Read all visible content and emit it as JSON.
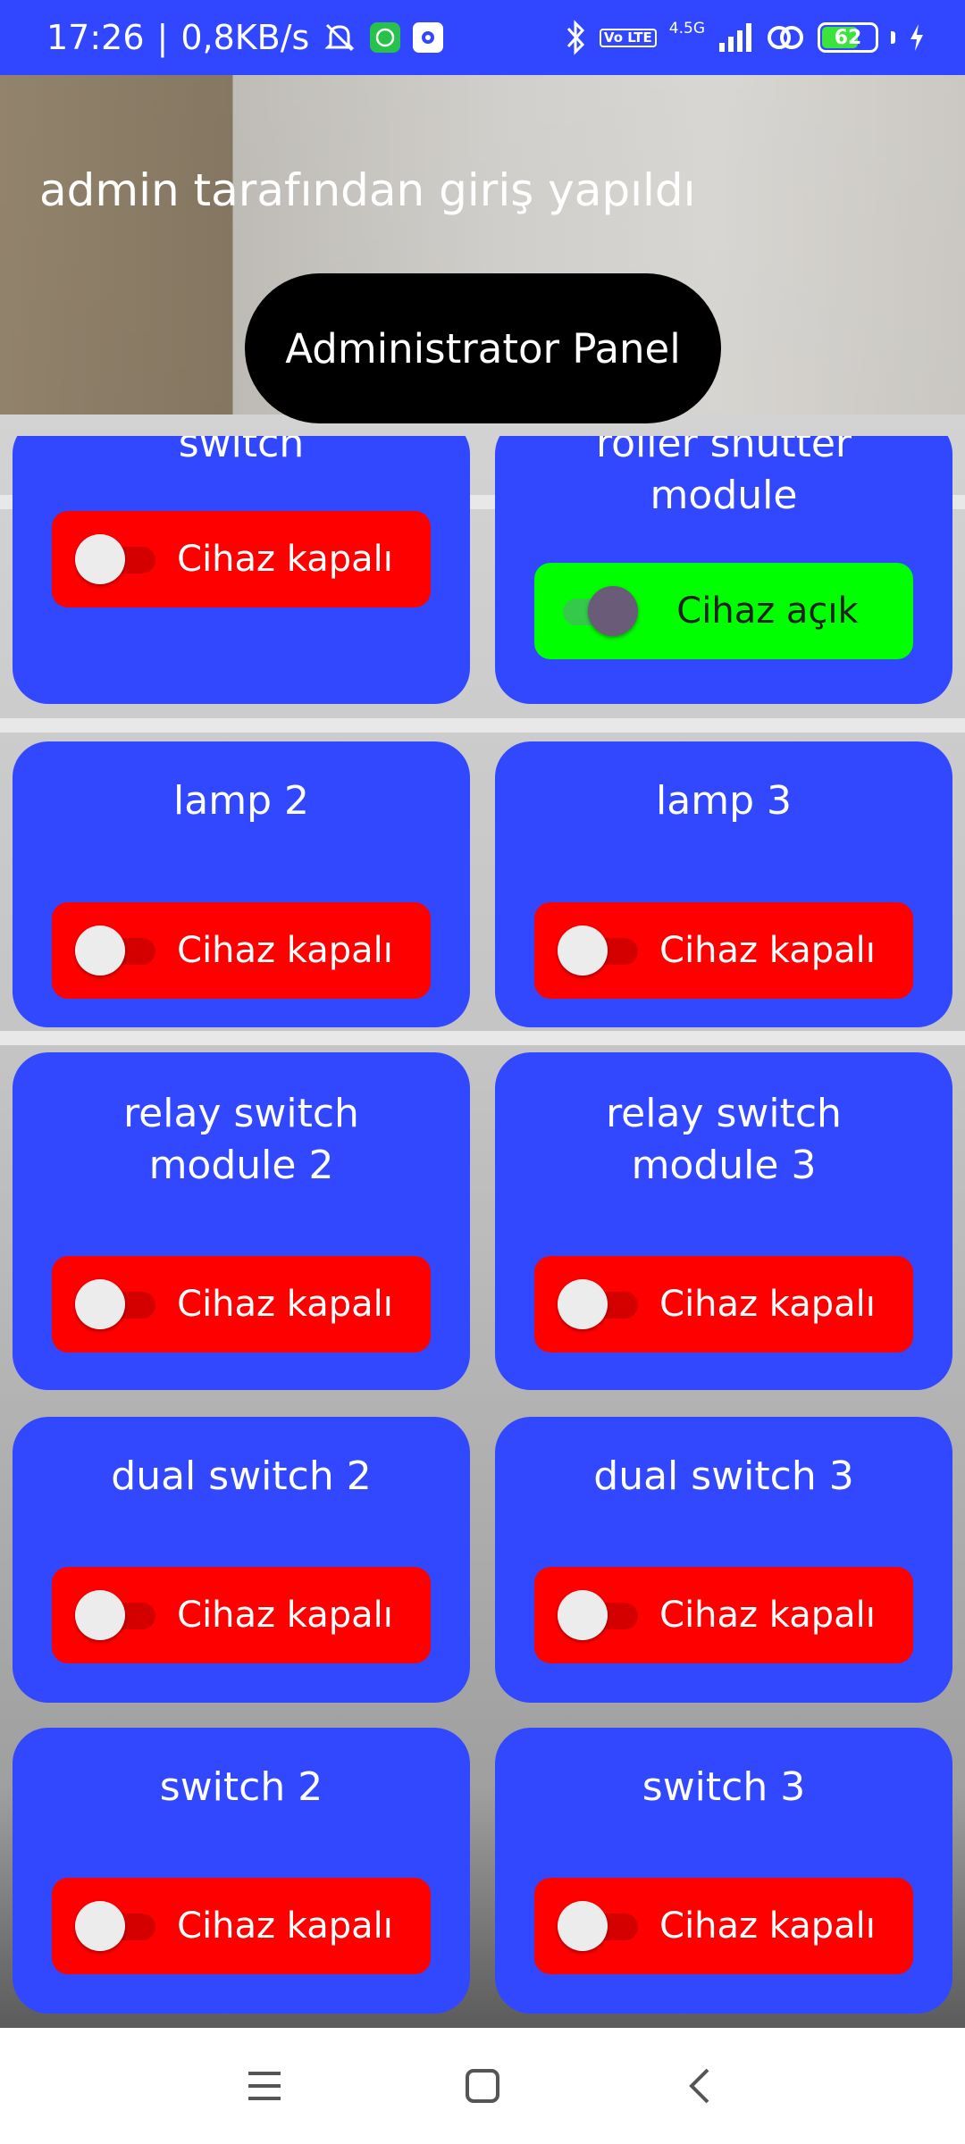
{
  "status_bar": {
    "time": "17:26",
    "speed": "0,8KB/s",
    "network": "4.5G",
    "lte_label": "Vo LTE",
    "battery": 62,
    "icons": [
      "mute-icon",
      "whatsapp-icon",
      "settings-icon",
      "bluetooth-icon",
      "signal-icon",
      "link-icon",
      "battery-icon",
      "charging-icon"
    ]
  },
  "header": {
    "login_text": "admin tarafından giriş yapıldı",
    "panel_button": "Administrator Panel"
  },
  "colors": {
    "card_bg": "#3148ff",
    "off_button": "#ff0000",
    "on_button": "#00ff00",
    "status_bar": "#3147ff"
  },
  "devices": [
    {
      "name": "switch",
      "status": "Cihaz kapalı",
      "on": false
    },
    {
      "name": "roller shutter module",
      "status": "Cihaz açık",
      "on": true
    },
    {
      "name": "lamp 2",
      "status": "Cihaz kapalı",
      "on": false
    },
    {
      "name": "lamp 3",
      "status": "Cihaz kapalı",
      "on": false
    },
    {
      "name": "relay switch module 2",
      "status": "Cihaz kapalı",
      "on": false
    },
    {
      "name": "relay switch module 3",
      "status": "Cihaz kapalı",
      "on": false
    },
    {
      "name": "dual switch 2",
      "status": "Cihaz kapalı",
      "on": false
    },
    {
      "name": "dual switch 3",
      "status": "Cihaz kapalı",
      "on": false
    },
    {
      "name": "switch 2",
      "status": "Cihaz kapalı",
      "on": false
    },
    {
      "name": "switch 3",
      "status": "Cihaz kapalı",
      "on": false
    }
  ],
  "nav_bar": {
    "buttons": [
      "menu-icon",
      "home-icon",
      "back-icon"
    ]
  }
}
